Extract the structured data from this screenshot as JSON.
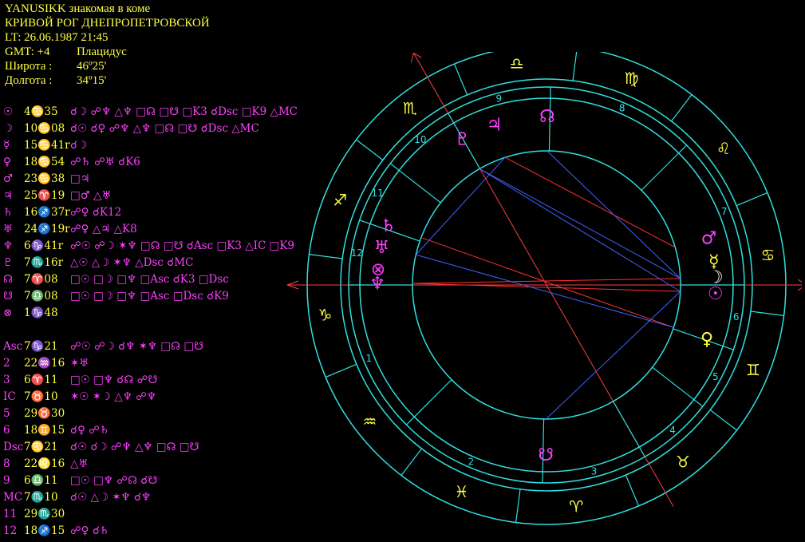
{
  "header": {
    "line1": "YANUSIKK знакомая в коме",
    "line2": "КРИВОЙ РОГ ДНЕПРОПЕТРОВСКОЙ",
    "line3": "LT: 26.06.1987  21:45",
    "gmt": "GMT: +4",
    "system": "Плацидус",
    "lat_label": "Широта :",
    "lat_value": "46º25'",
    "lon_label": "Долгота :",
    "lon_value": "34º15'"
  },
  "planets": [
    {
      "glyph": "☉",
      "pos": "4♋35",
      "aspects": "☌☽ ☍♆ △♆ □☊ □☋  □K3 ☌Dsc □K9 △MC"
    },
    {
      "glyph": "☽",
      "pos": "10♋08",
      "aspects": "☌☉ ☌♀ ☍♆ △♆ □☊ □☋  ☌Dsc △MC"
    },
    {
      "glyph": "☿",
      "pos": "15♋41r",
      "aspects": "☌☽"
    },
    {
      "glyph": "♀",
      "pos": "18♋54",
      "aspects": "☍♄ ☍♅ ☌K6"
    },
    {
      "glyph": "♂",
      "pos": "23♋38",
      "aspects": "□♃"
    },
    {
      "glyph": "♃",
      "pos": "25♈19",
      "aspects": "□♂ △♅"
    },
    {
      "glyph": "♄",
      "pos": "16♐37r",
      "aspects": "☍♀ ☌K12"
    },
    {
      "glyph": "♅",
      "pos": "24♐19r",
      "aspects": "☍♀ △♃ △K8"
    },
    {
      "glyph": "♆",
      "pos": "6♑41r",
      "aspects": "☍☉ ☍☽ ✶♆ □☊ □☋  ☌Asc □K3 △IC □K9"
    },
    {
      "glyph": "♇",
      "pos": "7♏16r",
      "aspects": "△☉ △☽ ✶♆ △Dsc ☌MC"
    },
    {
      "glyph": "☊",
      "pos": "7♈08",
      "aspects": "□☉ □☽ □♆ □Asc ☌K3 □Dsc"
    },
    {
      "glyph": "☋",
      "pos": "7♎08",
      "aspects": "□☉ □☽ □♆ □Asc □Dsc ☌K9"
    },
    {
      "glyph": "⊗",
      "pos": "1♑48",
      "aspects": ""
    }
  ],
  "houses": [
    {
      "label": "Asc",
      "pos": "7♑21",
      "aspects": "☍☉ ☍☽ ☌♆ ✶♆ □☊ □☋"
    },
    {
      "label": "2",
      "pos": "22♒16",
      "aspects": "✶♅"
    },
    {
      "label": "3",
      "pos": "6♈11",
      "aspects": "□☉ □♆ ☌☊ ☍☋"
    },
    {
      "label": "IC",
      "pos": "7♉10",
      "aspects": "✶☉ ✶☽ △♆ ☍♆"
    },
    {
      "label": "5",
      "pos": "29♉30",
      "aspects": ""
    },
    {
      "label": "6",
      "pos": "18♊15",
      "aspects": "☌♀ ☍♄"
    },
    {
      "label": "Dsc",
      "pos": "7♋21",
      "aspects": "☌☉ ☌☽ ☍♆ △♆ □☊ □☋"
    },
    {
      "label": "8",
      "pos": "22♌16",
      "aspects": "△♅"
    },
    {
      "label": "9",
      "pos": "6♎11",
      "aspects": "□☉ □♆ ☍☊ ☌☋"
    },
    {
      "label": "MC",
      "pos": "7♏10",
      "aspects": "☌☉ △☽ ✶♆ ☌♆"
    },
    {
      "label": "11",
      "pos": "29♏30",
      "aspects": ""
    },
    {
      "label": "12",
      "pos": "18♐15",
      "aspects": "☍♀ ☌♄"
    }
  ],
  "wheel": {
    "asc_deg": 277.35,
    "mc_deg": 217.17,
    "cusps": [
      277.35,
      322.27,
      6.18,
      37.17,
      59.5,
      78.25,
      97.35,
      142.27,
      186.18,
      217.17,
      239.5,
      258.25
    ],
    "house_numbers": [
      "1",
      "2",
      "3",
      "4",
      "5",
      "6",
      "7",
      "8",
      "9",
      "10",
      "11",
      "12"
    ],
    "signs": [
      "♈",
      "♉",
      "♊",
      "♋",
      "♌",
      "♍",
      "♎",
      "♏",
      "♐",
      "♑",
      "♒",
      "♓"
    ],
    "bodies": [
      {
        "glyph": "☉",
        "lon": 94.58,
        "color": "#ff40ff"
      },
      {
        "glyph": "☽",
        "lon": 100.13,
        "color": "#ffffff"
      },
      {
        "glyph": "☿",
        "lon": 105.68,
        "color": "#ffff40"
      },
      {
        "glyph": "♀",
        "lon": 78.9,
        "color": "#ffff40"
      },
      {
        "glyph": "♂",
        "lon": 113.63,
        "color": "#ff40ff"
      },
      {
        "glyph": "♃",
        "lon": 205.32,
        "color": "#ff40ff"
      },
      {
        "glyph": "♄",
        "lon": 256.62,
        "color": "#ff40ff"
      },
      {
        "glyph": "♅",
        "lon": 264.32,
        "color": "#ff40ff"
      },
      {
        "glyph": "♆",
        "lon": 276.68,
        "color": "#ff40ff"
      },
      {
        "glyph": "♇",
        "lon": 217.27,
        "color": "#ff40ff"
      },
      {
        "glyph": "☊",
        "lon": 187.13,
        "color": "#ff40ff"
      },
      {
        "glyph": "☋",
        "lon": 7.13,
        "color": "#ff40ff"
      },
      {
        "glyph": "⊗",
        "lon": 271.8,
        "color": "#ff40ff"
      }
    ],
    "aspect_lines": [
      {
        "a": 94.58,
        "b": 276.68,
        "color": "#ff3030"
      },
      {
        "a": 100.13,
        "b": 276.68,
        "color": "#ff3030"
      },
      {
        "a": 94.58,
        "b": 217.27,
        "color": "#4060ff"
      },
      {
        "a": 100.13,
        "b": 217.27,
        "color": "#4060ff"
      },
      {
        "a": 113.63,
        "b": 205.32,
        "color": "#ff3030"
      },
      {
        "a": 78.9,
        "b": 256.62,
        "color": "#ff3030"
      },
      {
        "a": 78.9,
        "b": 264.32,
        "color": "#4060ff"
      },
      {
        "a": 94.58,
        "b": 7.13,
        "color": "#4060ff"
      },
      {
        "a": 100.13,
        "b": 187.13,
        "color": "#4060ff"
      },
      {
        "a": 264.32,
        "b": 205.32,
        "color": "#4060ff"
      }
    ],
    "ring_color": "#30e0e0"
  }
}
